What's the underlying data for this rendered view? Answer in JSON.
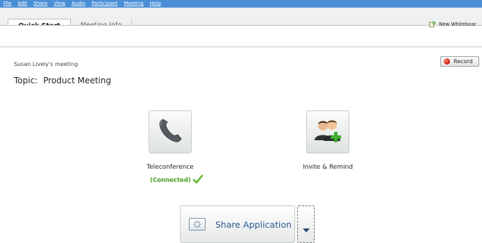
{
  "menu": [
    "File",
    "Edit",
    "Share",
    "View",
    "Audio",
    "Participant",
    "Meeting",
    "Help"
  ],
  "tabs": [
    {
      "label": "Quick Start",
      "active": true
    },
    {
      "label": "Meeting Info",
      "active": false
    }
  ],
  "toolbar": {
    "new_whiteboard_label": "New Whiteboar"
  },
  "meeting": {
    "host_line": "Susan Lively's meeting",
    "topic_prefix": "Topic:",
    "topic_name": "Product Meeting"
  },
  "record": {
    "label": "Record",
    "icon": "record-icon"
  },
  "actions": {
    "teleconference": {
      "label": "Teleconference",
      "status": "(Connected)",
      "icon": "phone-icon"
    },
    "invite": {
      "label": "Invite & Remind",
      "icon": "invite-people-icon"
    },
    "share": {
      "label": "Share Application",
      "icon": "share-application-icon"
    }
  },
  "colors": {
    "menubar": "#4a8fd6",
    "connected": "#4aa025",
    "share_text": "#2a5a94",
    "record": "#d4240f"
  }
}
